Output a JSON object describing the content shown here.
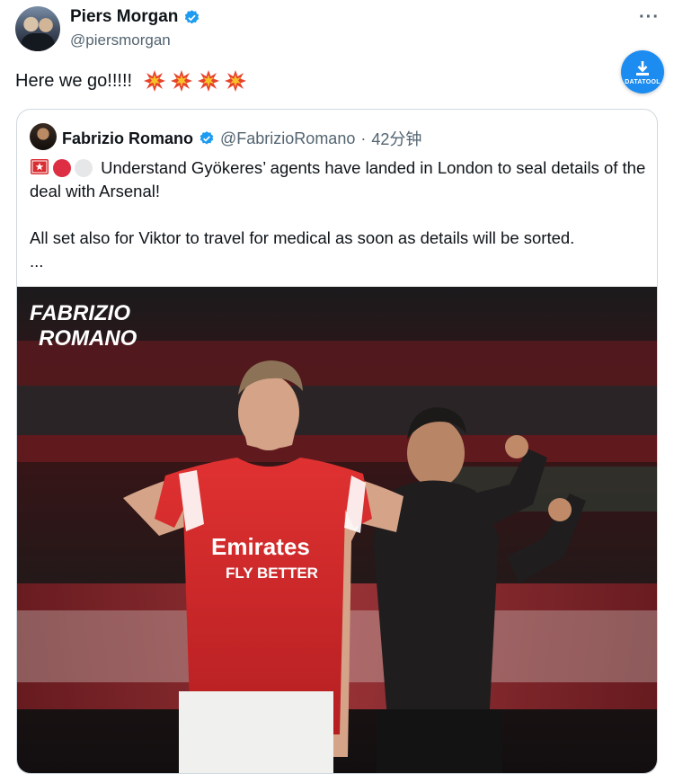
{
  "author": {
    "display_name": "Piers Morgan",
    "handle": "@piersmorgan"
  },
  "menu": {
    "more_label": "···"
  },
  "download_badge": {
    "label": "DATATOOL"
  },
  "tweet": {
    "text": "Here we go!!!!!",
    "emoji": [
      "collision-icon",
      "collision-icon",
      "collision-icon",
      "collision-icon"
    ]
  },
  "quoted": {
    "display_name": "Fabrizio Romano",
    "handle": "@FabrizioRomano",
    "separator": "·",
    "time": "42分钟",
    "line1": "Understand Gyökeres’ agents have landed in London to seal details of the deal with Arsenal!",
    "line2": "All set also for Viktor to travel for medical as soon as details will be sorted.",
    "ellipsis": "...",
    "emoji": [
      "flag-icon",
      "red-circle-icon",
      "white-circle-icon"
    ]
  },
  "image": {
    "watermark_line1": "FABRIZIO",
    "watermark_line2": "ROMANO",
    "shirt_sponsor": "Emirates",
    "shirt_tagline": "FLY BETTER"
  },
  "colors": {
    "verified": "#1d9bf0",
    "accent_red": "#db0007",
    "muted_text": "#536471"
  }
}
